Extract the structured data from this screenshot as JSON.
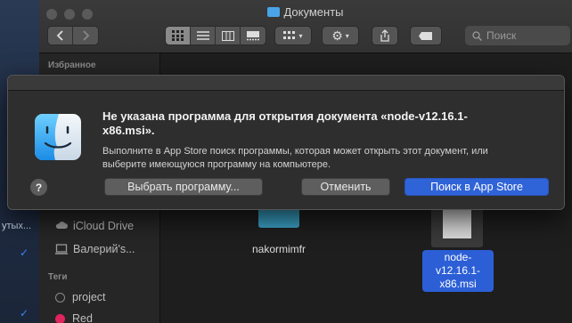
{
  "window": {
    "title": "Документы"
  },
  "toolbar": {
    "search_placeholder": "Поиск",
    "back_icon": "chevron-left-icon",
    "forward_icon": "chevron-right-icon"
  },
  "sidebar": {
    "favorites_header": "Избранное",
    "icloud_drive": "iCloud Drive",
    "computer": "Валерий's...",
    "tags_header": "Теги",
    "tags": [
      {
        "label": "project",
        "color": "#5a5a5a"
      },
      {
        "label": "Red",
        "color": "#e0245e"
      }
    ]
  },
  "background_fragments": {
    "text1": "утых..."
  },
  "files": [
    {
      "name": "nakormimfr",
      "selected": false
    },
    {
      "name_line1": "node-v12.16.1-",
      "name_line2": "x86.msi",
      "selected": true
    }
  ],
  "dialog": {
    "title_line1": "Не указана программа для открытия документа «node-v12.16.1-",
    "title_line2": "x86.msi».",
    "message_line1": "Выполните в App Store поиск программы, которая может открыть этот документ, или",
    "message_line2": "выберите имеющуюся программу на компьютере.",
    "help": "?",
    "choose_button": "Выбрать программу...",
    "cancel_button": "Отменить",
    "appstore_button": "Поиск в App Store"
  },
  "colors": {
    "accent": "#2f63d8",
    "selection": "#2c5fd6"
  }
}
